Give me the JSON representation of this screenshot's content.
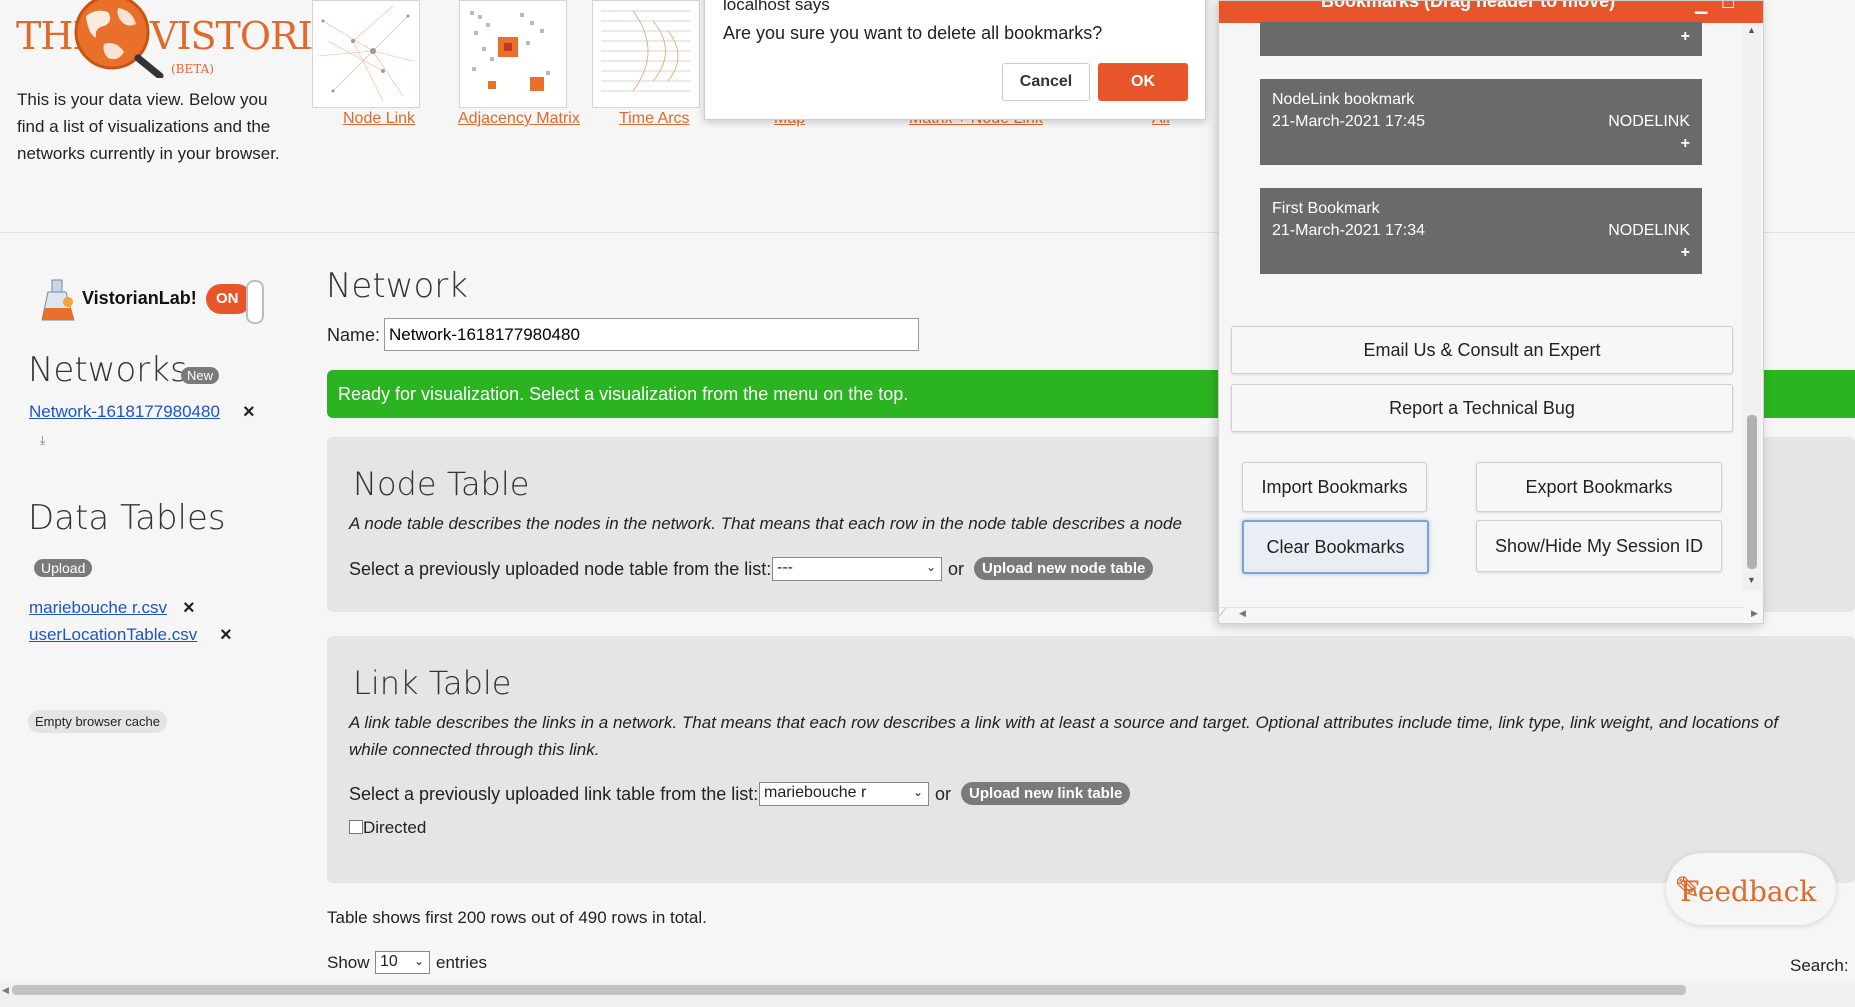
{
  "logo": {
    "left_text": "THE",
    "right_text": "VISTORIAN",
    "beta": "(BETA)"
  },
  "intro_text": "This is your data view. Below you find a list of visualizations and the networks currently in your browser.",
  "visualizations": [
    {
      "label": "Node Link"
    },
    {
      "label": "Adjacency Matrix"
    },
    {
      "label": "Time Arcs"
    },
    {
      "label": "Map"
    },
    {
      "label": "Matrix + Node Link"
    },
    {
      "label": "All"
    }
  ],
  "dialog": {
    "title": "localhost says",
    "message": "Are you sure you want to delete all bookmarks?",
    "cancel": "Cancel",
    "ok": "OK"
  },
  "lab": {
    "label": "VistorianLab!",
    "toggle": "ON"
  },
  "networks": {
    "heading": "Networks",
    "badge": "New",
    "items": [
      {
        "name": "Network-1618177980480"
      }
    ]
  },
  "data_tables": {
    "heading": "Data Tables",
    "upload": "Upload",
    "items": [
      {
        "name": "mariebouche r.csv"
      },
      {
        "name": "userLocationTable.csv"
      }
    ]
  },
  "empty_cache": "Empty browser cache",
  "network": {
    "heading": "Network",
    "name_label": "Name:",
    "name_value": "Network-1618177980480",
    "status": "Ready for visualization. Select a visualization from the menu on the top."
  },
  "node_table": {
    "heading": "Node Table",
    "desc": "A node table describes the nodes in the network. That means that each row in the node table describes a node",
    "select_label": "Select a previously uploaded node table from the list:",
    "select_value": "---",
    "or": "or",
    "upload": "Upload new node table"
  },
  "link_table": {
    "heading": "Link Table",
    "desc_line1": "A link table describes the links in a network. That means that each row describes a link with at least a source and target. Optional attributes include time, link type, link weight, and locations of",
    "desc_line2": "while connected through this link.",
    "select_label": "Select a previously uploaded link table from the list:",
    "select_value": "mariebouche r",
    "or": "or",
    "upload": "Upload new link table",
    "directed": "Directed"
  },
  "table_info": "Table shows first 200 rows out of 490 rows in total.",
  "show": {
    "prefix": "Show",
    "value": "10",
    "suffix": "entries"
  },
  "search_label": "Search:",
  "feedback": "Feedback",
  "bookmarks": {
    "header": "Bookmarks (Drag header to move)",
    "items": [
      {
        "title": "NodeLink bookmark",
        "date": "21-March-2021 17:45",
        "type": "NODELINK",
        "plus": "+"
      },
      {
        "title": "First Bookmark",
        "date": "21-March-2021 17:34",
        "type": "NODELINK",
        "plus": "+"
      }
    ],
    "top_plus": "+",
    "email": "Email Us & Consult an Expert",
    "bug": "Report a Technical Bug",
    "import": "Import Bookmarks",
    "export": "Export Bookmarks",
    "clear": "Clear Bookmarks",
    "session": "Show/Hide My Session ID"
  },
  "colors": {
    "accent": "#e8552b",
    "success": "#2bb321",
    "panel_item": "#6a6a6a"
  }
}
